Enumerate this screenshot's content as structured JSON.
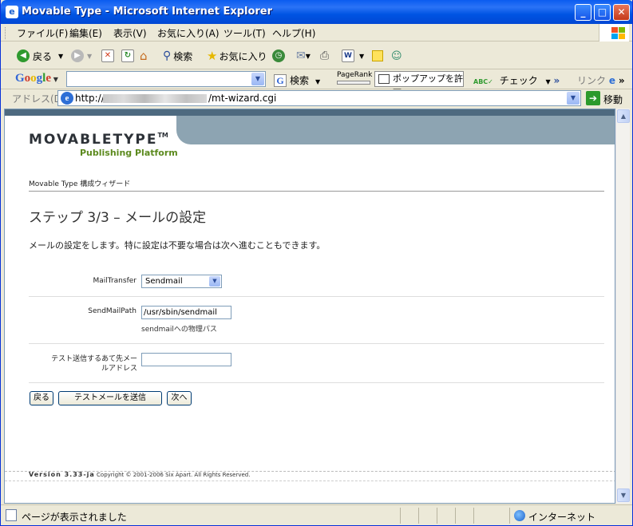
{
  "window": {
    "title": "Movable Type - Microsoft Internet Explorer",
    "minimize": "_",
    "maximize": "□",
    "close": "✕"
  },
  "menu": [
    "ファイル(F)",
    "編集(E)",
    "表示(V)",
    "お気に入り(A)",
    "ツール(T)",
    "ヘルプ(H)"
  ],
  "toolbar": {
    "back": "戻る",
    "search": "検索",
    "favorites": "お気に入り"
  },
  "googlebar": {
    "logo": "Google",
    "search": "検索",
    "pagerank": "PageRank",
    "popup": "ポップアップを許可",
    "check": "チェック",
    "links": "リンク"
  },
  "address": {
    "label": "アドレス(D)",
    "url_prefix": "http://",
    "url_suffix": "/mt-wizard.cgi",
    "go": "移動"
  },
  "page": {
    "logo_main": "MOVABLETYPE",
    "logo_tm": "TM",
    "logo_sub": "Publishing Platform",
    "breadcrumb": "Movable Type 構成ウィザード",
    "title": "ステップ 3/3 – メールの設定",
    "intro": "メールの設定をします。特に設定は不要な場合は次へ進むこともできます。",
    "mail_transfer_label": "MailTransfer",
    "mail_transfer_value": "Sendmail",
    "sendmail_path_label": "SendMailPath",
    "sendmail_path_value": "/usr/sbin/sendmail",
    "sendmail_path_hint": "sendmailへの物理パス",
    "test_address_label_1": "テスト送信するあて先メー",
    "test_address_label_2": "ルアドレス",
    "test_address_value": "",
    "back_button": "戻る",
    "send_test_button": "テストメールを送信",
    "next_button": "次へ",
    "footer_version": "Version 3.33-ja",
    "footer_copyright": "Copyright © 2001-2006 Six Apart. All Rights Reserved."
  },
  "status": {
    "message": "ページが表示されました",
    "zone": "インターネット"
  }
}
